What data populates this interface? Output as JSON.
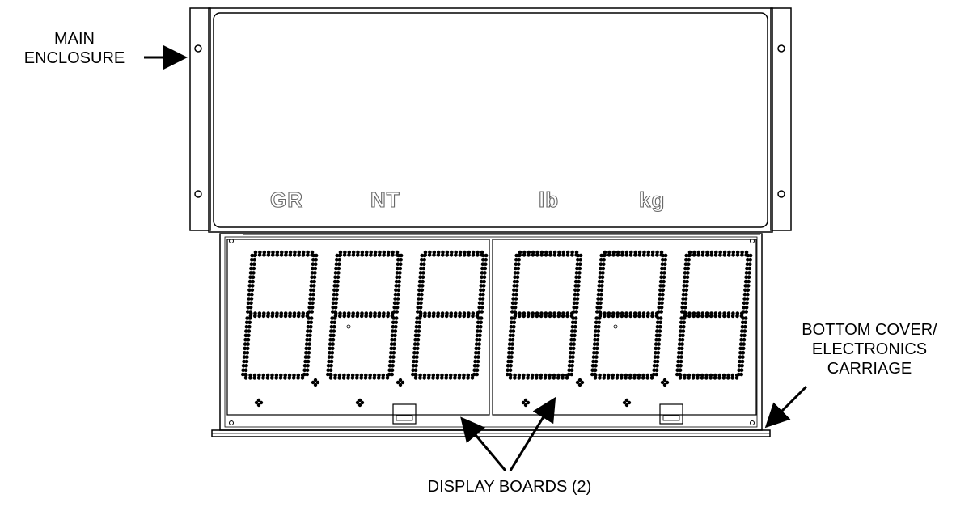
{
  "callouts": {
    "main_enclosure": [
      "MAIN",
      "ENCLOSURE"
    ],
    "bottom_cover": [
      "BOTTOM COVER/",
      "ELECTRONICS",
      "CARRIAGE"
    ],
    "display_boards": "DISPLAY BOARDS (2)"
  },
  "unit_labels": [
    "GR",
    "NT",
    "lb",
    "kg"
  ],
  "display": {
    "digit_count": 6,
    "board_count": 2
  },
  "colors": {
    "line": "#000000",
    "annunciator_outline": "#666666",
    "background": "#ffffff"
  }
}
